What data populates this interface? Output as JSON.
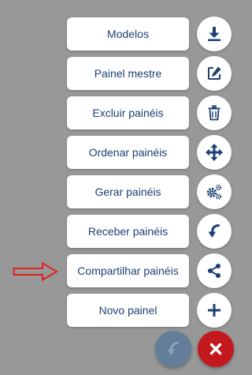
{
  "menu": {
    "items": [
      {
        "label": "Modelos",
        "icon": "download-icon"
      },
      {
        "label": "Painel mestre",
        "icon": "edit-icon"
      },
      {
        "label": "Excluir painéis",
        "icon": "trash-icon"
      },
      {
        "label": "Ordenar painéis",
        "icon": "move-arrows-icon"
      },
      {
        "label": "Gerar painéis",
        "icon": "gears-icon"
      },
      {
        "label": "Receber painéis",
        "icon": "curved-arrow-down-icon"
      },
      {
        "label": "Compartilhar painéis",
        "icon": "share-icon"
      },
      {
        "label": "Novo painel",
        "icon": "plus-icon"
      }
    ]
  },
  "fab": {
    "receive_icon": "curved-arrow-down-icon",
    "close_icon": "close-icon"
  },
  "colors": {
    "background": "#989898",
    "label_text": "#1c3f73",
    "icon": "#1c3f73",
    "pointer_arrow": "#e02020",
    "fab_receive": "#647e99",
    "fab_close": "#c3181c"
  }
}
